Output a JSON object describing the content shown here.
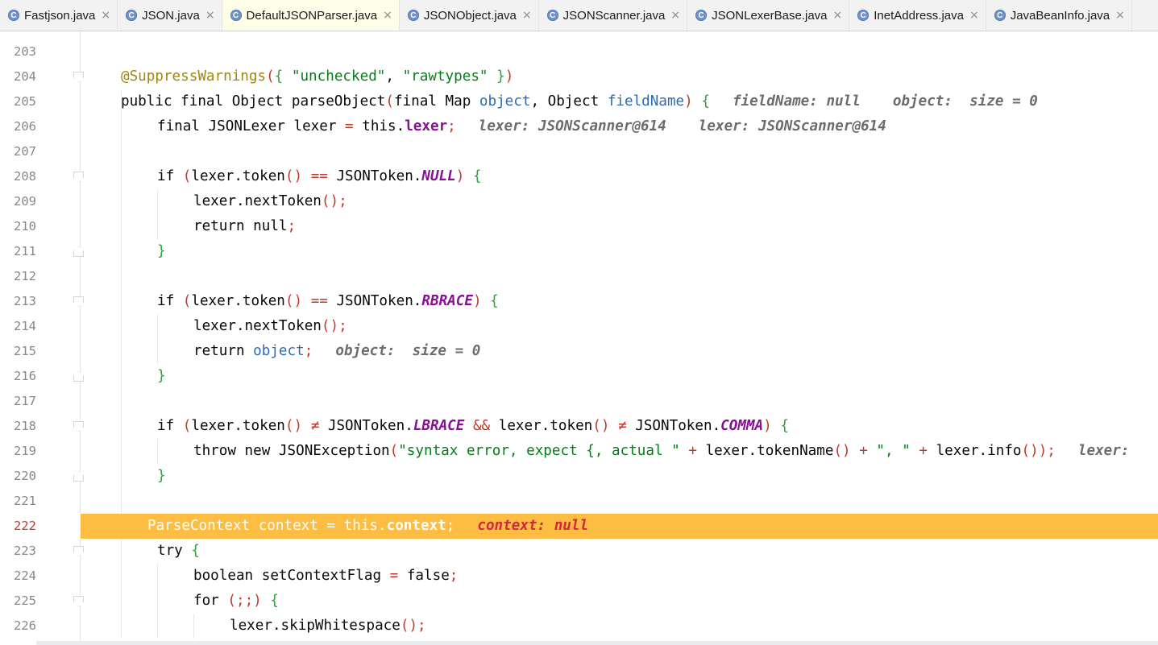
{
  "tabs": [
    {
      "label": "Fastjson.java",
      "icon": "class-icon",
      "active": false
    },
    {
      "label": "JSON.java",
      "icon": "class-icon",
      "active": false
    },
    {
      "label": "DefaultJSONParser.java",
      "icon": "class-icon",
      "active": true
    },
    {
      "label": "JSONObject.java",
      "icon": "class-icon",
      "active": false
    },
    {
      "label": "JSONScanner.java",
      "icon": "class-icon",
      "active": false
    },
    {
      "label": "JSONLexerBase.java",
      "icon": "class-icon",
      "active": false
    },
    {
      "label": "InetAddress.java",
      "icon": "class-icon",
      "active": false
    },
    {
      "label": "JavaBeanInfo.java",
      "icon": "class-icon",
      "active": false
    }
  ],
  "tab_icon_glyph": "C",
  "tab_close_glyph": "×",
  "colors": {
    "keyword": "#0033b3",
    "string": "#067d17",
    "annotation": "#9e880d",
    "field": "#871094",
    "execution_line": "#fdbd42",
    "inlay_hint": "#6c6c6c"
  },
  "editor": {
    "current_line": "222",
    "lines": [
      {
        "num": "203",
        "code": ""
      },
      {
        "num": "204",
        "code": "@SuppressWarnings({ \"unchecked\", \"rawtypes\" })"
      },
      {
        "num": "205",
        "code": "public final Object parseObject(final Map object, Object fieldName) {",
        "hint": "fieldName: null",
        "hint2": "object:  size = 0"
      },
      {
        "num": "206",
        "code": "final JSONLexer lexer = this.lexer;",
        "hint": "lexer: JSONScanner@614",
        "hint2": "lexer: JSONScanner@614"
      },
      {
        "num": "207",
        "code": ""
      },
      {
        "num": "208",
        "code": "if (lexer.token() == JSONToken.NULL) {"
      },
      {
        "num": "209",
        "code": "lexer.nextToken();"
      },
      {
        "num": "210",
        "code": "return null;"
      },
      {
        "num": "211",
        "code": "}"
      },
      {
        "num": "212",
        "code": ""
      },
      {
        "num": "213",
        "code": "if (lexer.token() == JSONToken.RBRACE) {"
      },
      {
        "num": "214",
        "code": "lexer.nextToken();"
      },
      {
        "num": "215",
        "code": "return object;",
        "hint": "object:  size = 0"
      },
      {
        "num": "216",
        "code": "}"
      },
      {
        "num": "217",
        "code": ""
      },
      {
        "num": "218",
        "code": "if (lexer.token() ≠ JSONToken.LBRACE && lexer.token() ≠ JSONToken.COMMA) {"
      },
      {
        "num": "219",
        "code": "throw new JSONException(\"syntax error, expect {, actual \" + lexer.tokenName() + \", \" + lexer.info());",
        "hint": "lexer:"
      },
      {
        "num": "220",
        "code": "}"
      },
      {
        "num": "221",
        "code": ""
      },
      {
        "num": "222",
        "code": "ParseContext context = this.context;",
        "hint": "context: null"
      },
      {
        "num": "223",
        "code": "try {"
      },
      {
        "num": "224",
        "code": "boolean setContextFlag = false;"
      },
      {
        "num": "225",
        "code": "for (;;) {"
      },
      {
        "num": "226",
        "code": "lexer.skipWhitespace();"
      }
    ]
  }
}
